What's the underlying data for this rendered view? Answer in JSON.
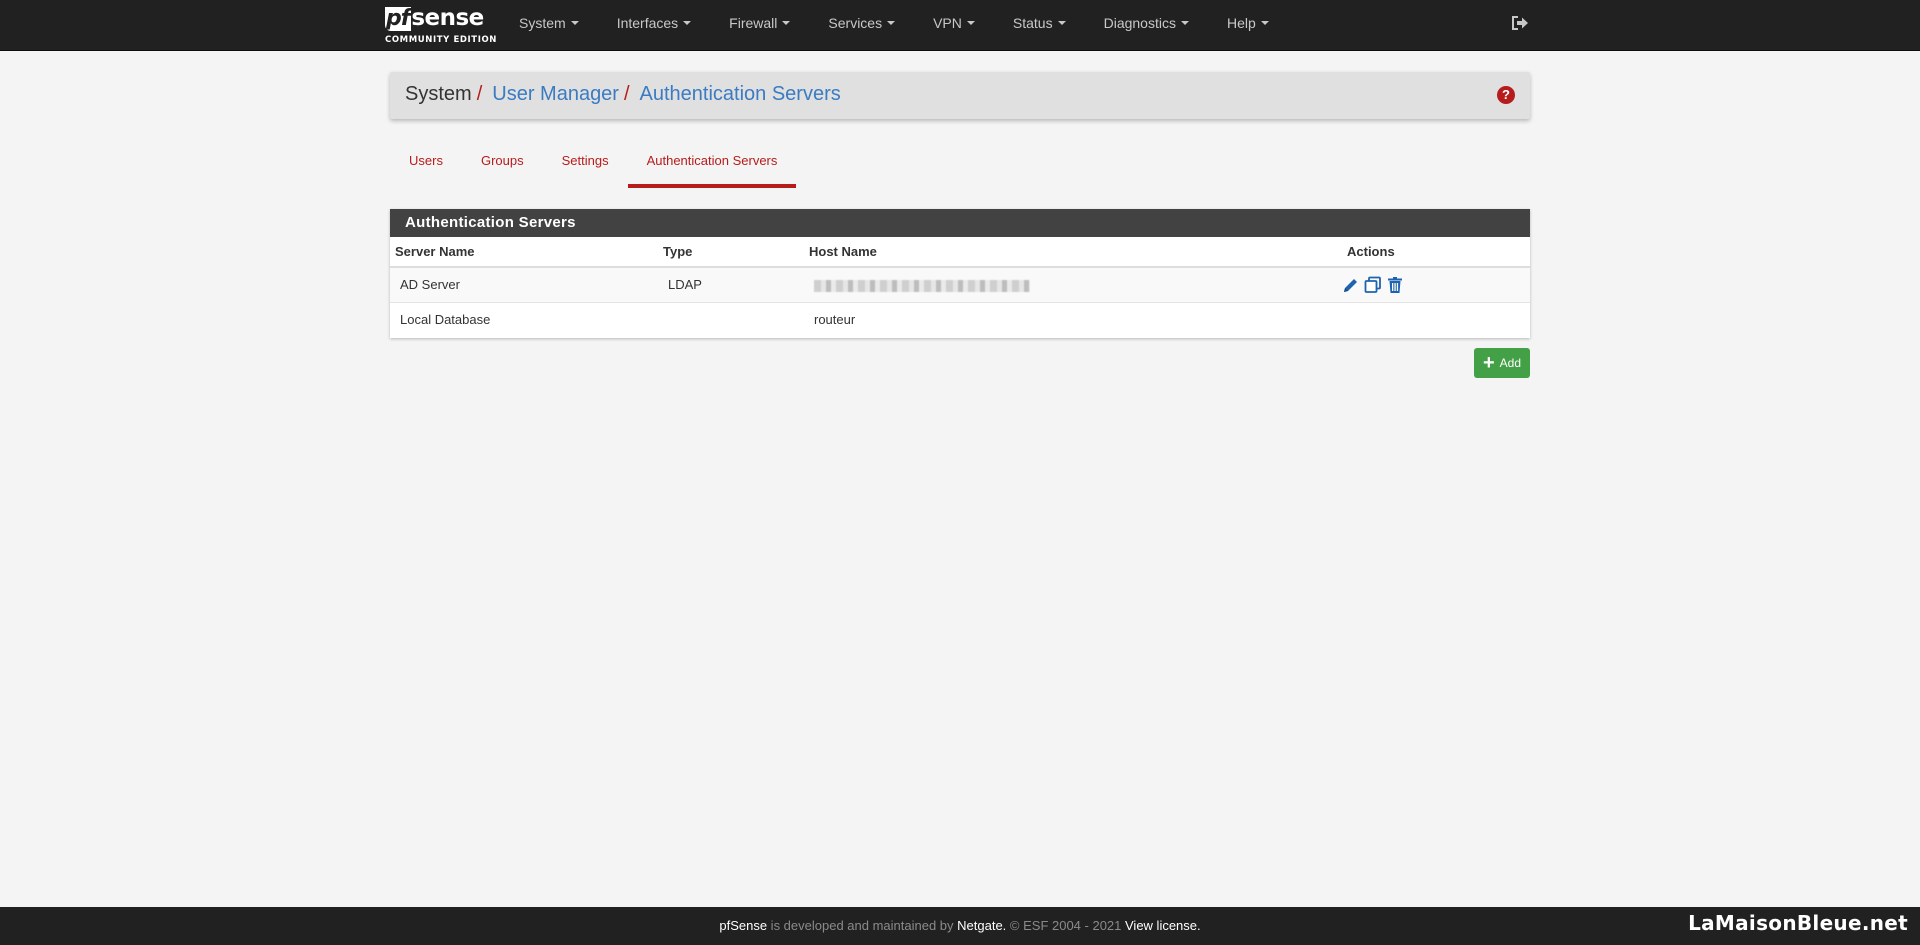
{
  "brand": {
    "logo_pf": "pf",
    "logo_sense": "sense",
    "edition": "COMMUNITY EDITION"
  },
  "nav": {
    "items": [
      {
        "label": "System"
      },
      {
        "label": "Interfaces"
      },
      {
        "label": "Firewall"
      },
      {
        "label": "Services"
      },
      {
        "label": "VPN"
      },
      {
        "label": "Status"
      },
      {
        "label": "Diagnostics"
      },
      {
        "label": "Help"
      }
    ],
    "logout_icon": "sign-out-icon"
  },
  "breadcrumb": {
    "root": "System",
    "sep": "/",
    "level1": "User Manager",
    "level2": "Authentication Servers",
    "help_icon": "question-circle-icon",
    "help_glyph": "?"
  },
  "tabs": [
    {
      "label": "Users",
      "active": false
    },
    {
      "label": "Groups",
      "active": false
    },
    {
      "label": "Settings",
      "active": false
    },
    {
      "label": "Authentication Servers",
      "active": true
    }
  ],
  "panel": {
    "title": "Authentication Servers",
    "columns": [
      "Server Name",
      "Type",
      "Host Name",
      "Actions"
    ],
    "rows": [
      {
        "name": "AD Server",
        "type": "LDAP",
        "host": "",
        "host_blurred": true,
        "actions": [
          "pencil-icon",
          "clone-icon",
          "trash-icon"
        ]
      },
      {
        "name": "Local Database",
        "type": "",
        "host": "routeur",
        "host_blurred": false,
        "actions": []
      }
    ]
  },
  "add_button": {
    "label": "Add",
    "icon": "plus-icon"
  },
  "footer": {
    "product": "pfSense",
    "dev_text": " is developed and maintained by ",
    "company": "Netgate.",
    "copyright": " © ESF 2004 - 2021 ",
    "license_link": "View license."
  },
  "watermark": "LaMaisonBleue.net",
  "colors": {
    "navbar_bg": "#212121",
    "accent_red": "#b71c1c",
    "link_blue": "#3a7bc2",
    "panel_heading": "#424242",
    "add_green": "#43a047",
    "action_blue": "#1e63b0"
  }
}
